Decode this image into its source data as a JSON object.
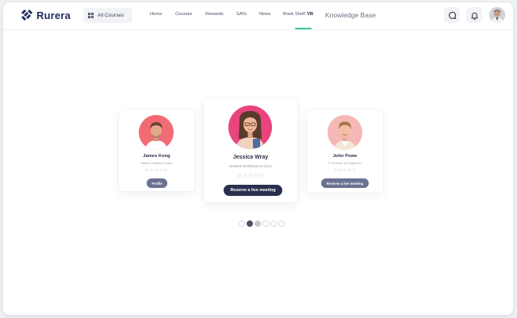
{
  "brand": {
    "name": "Rurera"
  },
  "header": {
    "all_courses": "All Courses",
    "nav": [
      "Home",
      "Courses",
      "Rewards",
      "SATs",
      "News",
      "Book Shelf",
      "VB"
    ],
    "knowledge_base": "Knowledge Base"
  },
  "icons": {
    "chat": "chat-bubble-icon",
    "bell": "bell-icon",
    "grid": "grid-icon",
    "star": "star-outline-icon"
  },
  "teachers": [
    {
      "name": "James Kong",
      "role": "Maths Certified Coach",
      "button": "Profile",
      "rating_filled": 0,
      "rating_max": 5
    },
    {
      "name": "Jessica Wray",
      "role": "Network Technician at Cisco",
      "button": "Reserve a live meeting",
      "rating_filled": 0,
      "rating_max": 5
    },
    {
      "name": "John Powe",
      "role": "IT Director at Engineers",
      "button": "Reserve a live meeting",
      "rating_filled": 0,
      "rating_max": 5
    }
  ],
  "carousel": {
    "total": 6,
    "active_index": 1
  },
  "colors": {
    "brand": "#1f2a5c",
    "accent_green": "#3cc886",
    "button_dark": "#2a2f4e",
    "button_muted": "#6b7190",
    "avatar_bg_pink": "#f26b74",
    "avatar_bg_magenta": "#e9457c",
    "avatar_bg_peach": "#f6b8b6"
  }
}
